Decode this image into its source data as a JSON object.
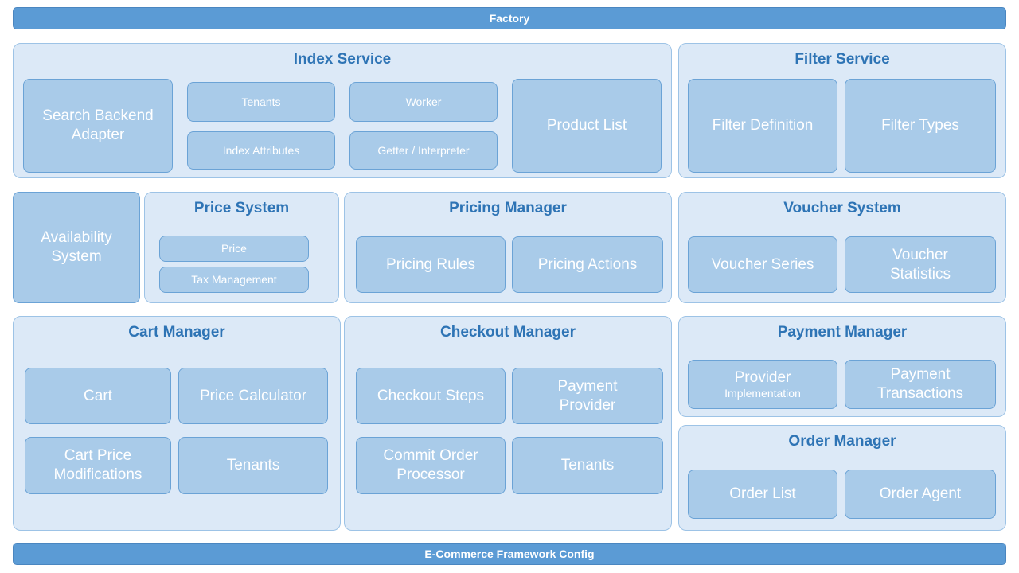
{
  "top_bar": {
    "label": "Factory"
  },
  "bottom_bar": {
    "label": "E-Commerce Framework Config"
  },
  "groups": {
    "index_service": {
      "title": "Index Service",
      "boxes": {
        "search_backend_adapter": "Search Backend Adapter",
        "tenants": "Tenants",
        "index_attributes": "Index Attributes",
        "worker": "Worker",
        "getter_interpreter": "Getter / Interpreter",
        "product_list": "Product List"
      }
    },
    "filter_service": {
      "title": "Filter Service",
      "boxes": {
        "filter_definition": "Filter Definition",
        "filter_types": "Filter Types"
      }
    },
    "availability_system": {
      "title": "Availability System"
    },
    "price_system": {
      "title": "Price System",
      "boxes": {
        "price": "Price",
        "tax_management": "Tax Management"
      }
    },
    "pricing_manager": {
      "title": "Pricing Manager",
      "boxes": {
        "pricing_rules": "Pricing Rules",
        "pricing_actions": "Pricing Actions"
      }
    },
    "voucher_system": {
      "title": "Voucher System",
      "boxes": {
        "voucher_series": "Voucher Series",
        "voucher_statistics_line1": "Voucher",
        "voucher_statistics_line2": "Statistics"
      }
    },
    "cart_manager": {
      "title": "Cart Manager",
      "boxes": {
        "cart": "Cart",
        "price_calculator": "Price Calculator",
        "cart_price_modifications_line1": "Cart Price",
        "cart_price_modifications_line2": "Modifications",
        "tenants": "Tenants"
      }
    },
    "checkout_manager": {
      "title": "Checkout Manager",
      "boxes": {
        "checkout_steps": "Checkout Steps",
        "payment_provider_line1": "Payment",
        "payment_provider_line2": "Provider",
        "commit_order_processor_line1": "Commit Order",
        "commit_order_processor_line2": "Processor",
        "tenants": "Tenants"
      }
    },
    "payment_manager": {
      "title": "Payment Manager",
      "boxes": {
        "provider_impl_line1": "Provider",
        "provider_impl_line2": "Implementation",
        "payment_transactions_line1": "Payment",
        "payment_transactions_line2": "Transactions"
      }
    },
    "order_manager": {
      "title": "Order Manager",
      "boxes": {
        "order_list": "Order List",
        "order_agent": "Order Agent"
      }
    }
  }
}
